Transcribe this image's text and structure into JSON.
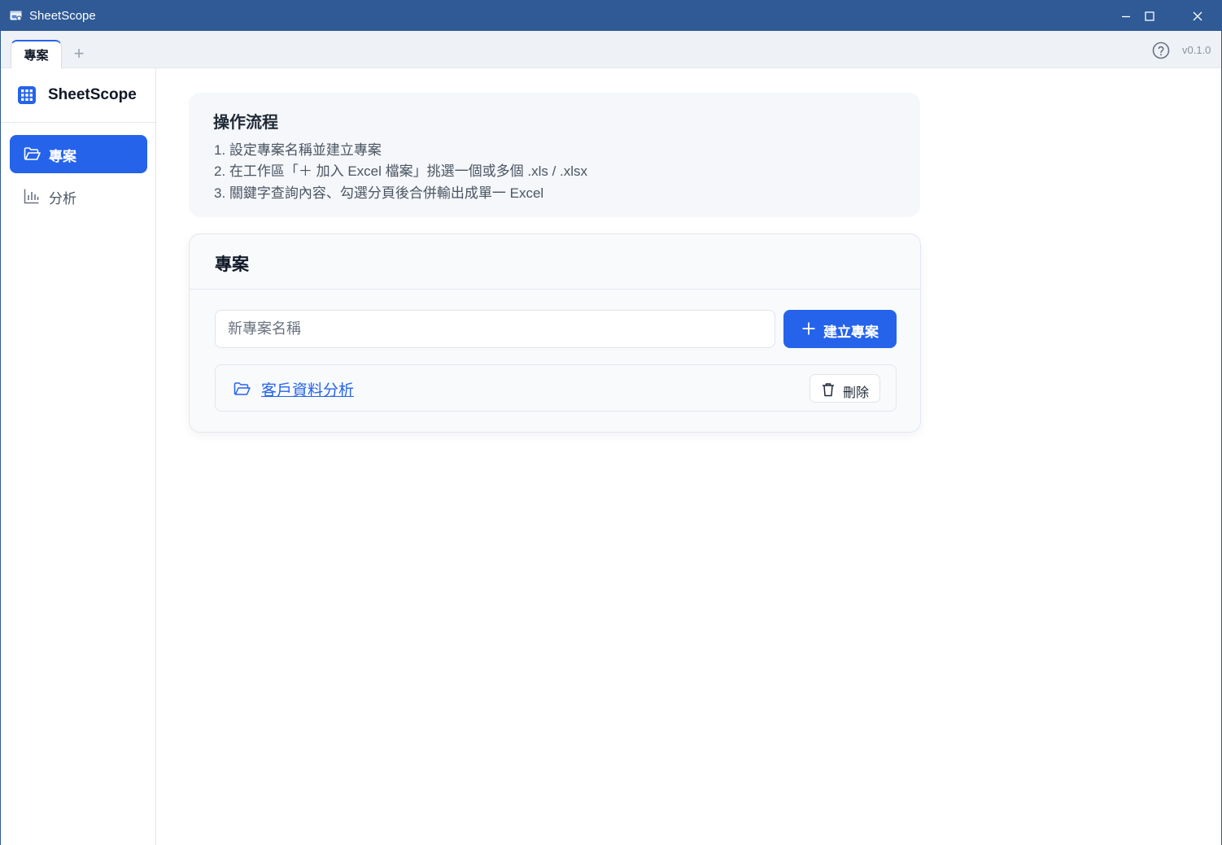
{
  "window": {
    "title": "SheetScope",
    "title_bar_color": "#2f5a96",
    "controls": [
      "minimize-icon",
      "maximize-icon",
      "close-icon"
    ]
  },
  "tabs": {
    "items": [
      {
        "label": "專案",
        "active": true
      }
    ],
    "add_icon": "plus-icon",
    "help_icon": "help-circle-icon",
    "version": "v0.1.0"
  },
  "sidebar": {
    "brand": {
      "name": "SheetScope",
      "icon": "grid-icon"
    },
    "items": [
      {
        "label": "專案",
        "icon": "folder-icon",
        "active": true
      },
      {
        "label": "分析",
        "icon": "bar-chart-icon",
        "active": false
      }
    ]
  },
  "guide": {
    "title": "操作流程",
    "steps": [
      "1. 設定專案名稱並建立專案",
      "2. 在工作區「＋ 加入 Excel 檔案」挑選一個或多個 .xls / .xlsx",
      "3. 關鍵字查詢內容、勾選分頁後合併輸出成單一 Excel"
    ]
  },
  "projects": {
    "title": "專案",
    "input": {
      "placeholder": "新專案名稱",
      "value": ""
    },
    "create_label": "建立專案",
    "create_icon": "plus-icon",
    "items": [
      {
        "name": "客戶資料分析",
        "icon": "folder-icon",
        "delete_label": "刪除",
        "delete_icon": "trash-icon"
      }
    ]
  },
  "colors": {
    "accent": "#2563eb",
    "card_bg": "#f8fafc",
    "guide_bg": "#f5f7fa"
  }
}
